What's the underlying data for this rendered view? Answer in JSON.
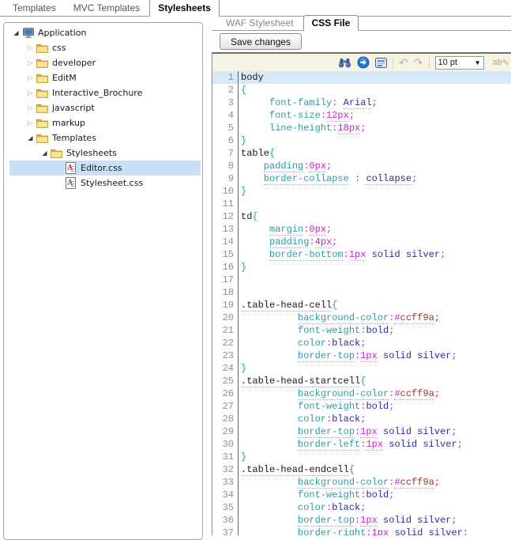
{
  "window": {
    "top_tabs": [
      {
        "label": "Templates",
        "active": false
      },
      {
        "label": "MVC Templates",
        "active": false
      },
      {
        "label": "Stylesheets",
        "active": true
      }
    ]
  },
  "tree": {
    "items": [
      {
        "label": "Application",
        "level": 0,
        "icon": "computer",
        "expander": "expanded",
        "selected": false
      },
      {
        "label": "css",
        "level": 1,
        "icon": "folder",
        "expander": "collapsed",
        "selected": false
      },
      {
        "label": "developer",
        "level": 1,
        "icon": "folder",
        "expander": "collapsed",
        "selected": false
      },
      {
        "label": "EditM",
        "level": 1,
        "icon": "folder",
        "expander": "collapsed",
        "selected": false
      },
      {
        "label": "Interactive_Brochure",
        "level": 1,
        "icon": "folder",
        "expander": "collapsed",
        "selected": false
      },
      {
        "label": "javascript",
        "level": 1,
        "icon": "folder",
        "expander": "collapsed",
        "selected": false
      },
      {
        "label": "markup",
        "level": 1,
        "icon": "folder",
        "expander": "collapsed",
        "selected": false
      },
      {
        "label": "Templates",
        "level": 1,
        "icon": "folder",
        "expander": "expanded",
        "selected": false
      },
      {
        "label": "Stylesheets",
        "level": 2,
        "icon": "folder",
        "expander": "expanded",
        "selected": false
      },
      {
        "label": "Editor.css",
        "level": 3,
        "icon": "css-file",
        "expander": "none",
        "selected": true
      },
      {
        "label": "Stylesheet.css",
        "level": 3,
        "icon": "css-file",
        "expander": "none",
        "selected": false
      }
    ]
  },
  "editor_panel": {
    "tabs": [
      {
        "label": "WAF Stylesheet",
        "active": false
      },
      {
        "label": "CSS File",
        "active": true
      }
    ],
    "save_button_label": "Save changes",
    "toolbar": {
      "icons": [
        "search-binoculars-icon",
        "go-icon",
        "selection-icon",
        "undo-icon",
        "redo-icon",
        "chevron-down-icon",
        "rename-icon"
      ],
      "font_size_value": "10 pt",
      "rename_label": "ab"
    }
  },
  "editor": {
    "lines": [
      {
        "n": 1,
        "cur": true,
        "t": [
          [
            "s",
            "body"
          ]
        ]
      },
      {
        "n": 2,
        "t": [
          [
            "b",
            "{"
          ]
        ]
      },
      {
        "n": 3,
        "t": [
          [
            "t",
            "     "
          ],
          [
            "p",
            "font-family"
          ],
          [
            "o",
            ":"
          ],
          [
            "t",
            " "
          ],
          [
            "v",
            "Arial",
            1
          ],
          [
            "o",
            ";"
          ]
        ]
      },
      {
        "n": 4,
        "t": [
          [
            "t",
            "     "
          ],
          [
            "p",
            "font-size"
          ],
          [
            "o",
            ":"
          ],
          [
            "n",
            "12px",
            1
          ],
          [
            "o",
            ";"
          ]
        ]
      },
      {
        "n": 5,
        "t": [
          [
            "t",
            "     "
          ],
          [
            "p",
            "line-height"
          ],
          [
            "o",
            ":"
          ],
          [
            "n",
            "18px",
            1
          ],
          [
            "o",
            ";"
          ]
        ]
      },
      {
        "n": 6,
        "t": [
          [
            "b",
            "}"
          ]
        ]
      },
      {
        "n": 7,
        "t": [
          [
            "s",
            "table"
          ],
          [
            "b",
            "{"
          ]
        ]
      },
      {
        "n": 8,
        "t": [
          [
            "t",
            "    "
          ],
          [
            "p",
            "padding",
            1
          ],
          [
            "o",
            ":"
          ],
          [
            "n",
            "0px",
            1
          ],
          [
            "o",
            ";"
          ]
        ]
      },
      {
        "n": 9,
        "t": [
          [
            "t",
            "    "
          ],
          [
            "p",
            "border-collapse",
            1
          ],
          [
            "t",
            " "
          ],
          [
            "o",
            ":"
          ],
          [
            "t",
            " "
          ],
          [
            "v",
            "collapse",
            1
          ],
          [
            "o",
            ";"
          ]
        ]
      },
      {
        "n": 10,
        "t": [
          [
            "b",
            "}"
          ]
        ]
      },
      {
        "n": 11,
        "t": []
      },
      {
        "n": 12,
        "t": [
          [
            "s",
            "td"
          ],
          [
            "b",
            "{"
          ]
        ]
      },
      {
        "n": 13,
        "t": [
          [
            "t",
            "     "
          ],
          [
            "p",
            "margin",
            1
          ],
          [
            "o",
            ":"
          ],
          [
            "n",
            "0px",
            1
          ],
          [
            "o",
            ";"
          ]
        ]
      },
      {
        "n": 14,
        "t": [
          [
            "t",
            "     "
          ],
          [
            "p",
            "padding",
            1
          ],
          [
            "o",
            ":"
          ],
          [
            "n",
            "4px",
            1
          ],
          [
            "o",
            ";"
          ]
        ]
      },
      {
        "n": 15,
        "t": [
          [
            "t",
            "     "
          ],
          [
            "p",
            "border-bottom",
            1
          ],
          [
            "o",
            ":"
          ],
          [
            "n",
            "1px",
            1
          ],
          [
            "t",
            " "
          ],
          [
            "v",
            "solid"
          ],
          [
            "t",
            " "
          ],
          [
            "v",
            "silver"
          ],
          [
            "o",
            ";"
          ]
        ]
      },
      {
        "n": 16,
        "t": [
          [
            "b",
            "}"
          ]
        ]
      },
      {
        "n": 17,
        "t": []
      },
      {
        "n": 18,
        "t": []
      },
      {
        "n": 19,
        "t": [
          [
            "s",
            ".table-head-cell",
            1
          ],
          [
            "b",
            "{"
          ]
        ]
      },
      {
        "n": 20,
        "t": [
          [
            "t",
            "          "
          ],
          [
            "p",
            "background-color",
            1
          ],
          [
            "o",
            ":"
          ],
          [
            "h",
            "#",
            1
          ],
          [
            "x",
            "ccff9a",
            1
          ],
          [
            "o",
            ";"
          ]
        ]
      },
      {
        "n": 21,
        "t": [
          [
            "t",
            "          "
          ],
          [
            "p",
            "font-weight"
          ],
          [
            "o",
            ":"
          ],
          [
            "v",
            "bold"
          ],
          [
            "o",
            ";"
          ]
        ]
      },
      {
        "n": 22,
        "t": [
          [
            "t",
            "          "
          ],
          [
            "p",
            "color"
          ],
          [
            "o",
            ":"
          ],
          [
            "v",
            "black"
          ],
          [
            "o",
            ";"
          ]
        ]
      },
      {
        "n": 23,
        "t": [
          [
            "t",
            "          "
          ],
          [
            "p",
            "border-top",
            1
          ],
          [
            "o",
            ":"
          ],
          [
            "n",
            "1px",
            1
          ],
          [
            "t",
            " "
          ],
          [
            "v",
            "solid"
          ],
          [
            "t",
            " "
          ],
          [
            "v",
            "silver"
          ],
          [
            "o",
            ";"
          ]
        ]
      },
      {
        "n": 24,
        "t": [
          [
            "b",
            "}"
          ]
        ]
      },
      {
        "n": 25,
        "t": [
          [
            "s",
            ".table-head-startcell",
            1
          ],
          [
            "b",
            "{"
          ]
        ]
      },
      {
        "n": 26,
        "t": [
          [
            "t",
            "          "
          ],
          [
            "p",
            "background-color",
            1
          ],
          [
            "o",
            ":"
          ],
          [
            "h",
            "#",
            1
          ],
          [
            "x",
            "ccff9a",
            1
          ],
          [
            "o",
            ";"
          ]
        ]
      },
      {
        "n": 27,
        "t": [
          [
            "t",
            "          "
          ],
          [
            "p",
            "font-weight"
          ],
          [
            "o",
            ":"
          ],
          [
            "v",
            "bold"
          ],
          [
            "o",
            ";"
          ]
        ]
      },
      {
        "n": 28,
        "t": [
          [
            "t",
            "          "
          ],
          [
            "p",
            "color"
          ],
          [
            "o",
            ":"
          ],
          [
            "v",
            "black"
          ],
          [
            "o",
            ";"
          ]
        ]
      },
      {
        "n": 29,
        "t": [
          [
            "t",
            "          "
          ],
          [
            "p",
            "border-top",
            1
          ],
          [
            "o",
            ":"
          ],
          [
            "n",
            "1px",
            1
          ],
          [
            "t",
            " "
          ],
          [
            "v",
            "solid"
          ],
          [
            "t",
            " "
          ],
          [
            "v",
            "silver"
          ],
          [
            "o",
            ";"
          ]
        ]
      },
      {
        "n": 30,
        "t": [
          [
            "t",
            "          "
          ],
          [
            "p",
            "border-left",
            1
          ],
          [
            "o",
            ":"
          ],
          [
            "n",
            "1px",
            1
          ],
          [
            "t",
            " "
          ],
          [
            "v",
            "solid"
          ],
          [
            "t",
            " "
          ],
          [
            "v",
            "silver"
          ],
          [
            "o",
            ";"
          ]
        ]
      },
      {
        "n": 31,
        "t": [
          [
            "b",
            "}"
          ]
        ]
      },
      {
        "n": 32,
        "t": [
          [
            "s",
            ".table-head-endcell",
            1
          ],
          [
            "b",
            "{"
          ]
        ]
      },
      {
        "n": 33,
        "t": [
          [
            "t",
            "          "
          ],
          [
            "p",
            "background-color",
            1
          ],
          [
            "o",
            ":"
          ],
          [
            "h",
            "#",
            1
          ],
          [
            "x",
            "ccff9a",
            1
          ],
          [
            "o",
            ";"
          ]
        ]
      },
      {
        "n": 34,
        "t": [
          [
            "t",
            "          "
          ],
          [
            "p",
            "font-weight"
          ],
          [
            "o",
            ":"
          ],
          [
            "v",
            "bold"
          ],
          [
            "o",
            ";"
          ]
        ]
      },
      {
        "n": 35,
        "t": [
          [
            "t",
            "          "
          ],
          [
            "p",
            "color"
          ],
          [
            "o",
            ":"
          ],
          [
            "v",
            "black"
          ],
          [
            "o",
            ";"
          ]
        ]
      },
      {
        "n": 36,
        "t": [
          [
            "t",
            "          "
          ],
          [
            "p",
            "border-top",
            1
          ],
          [
            "o",
            ":"
          ],
          [
            "n",
            "1px",
            1
          ],
          [
            "t",
            " "
          ],
          [
            "v",
            "solid"
          ],
          [
            "t",
            " "
          ],
          [
            "v",
            "silver"
          ],
          [
            "o",
            ";"
          ]
        ]
      },
      {
        "n": 37,
        "t": [
          [
            "t",
            "          "
          ],
          [
            "p",
            "border-right",
            1
          ],
          [
            "o",
            ":"
          ],
          [
            "n",
            "1px",
            1
          ],
          [
            "t",
            " "
          ],
          [
            "v",
            "solid"
          ],
          [
            "t",
            " "
          ],
          [
            "v",
            "silver"
          ],
          [
            "o",
            ";"
          ]
        ]
      }
    ]
  },
  "colors": {
    "selector": "#1a1a1a",
    "brace": "#2e9ba8",
    "property": "#2e9ba8",
    "punct": "#cc22cc",
    "number": "#cc22cc",
    "value": "#2b2ba8",
    "hash": "#cc22cc",
    "hex": "#a03434",
    "line_number": "#8f8f8f",
    "current_line_bg": "#d6e9f9",
    "squiggle": "#e88a8a",
    "toolbar_bg": "#f6f3e2",
    "selected_row_bg": "#c9e0f7",
    "tab_border": "#8f8f8f"
  }
}
